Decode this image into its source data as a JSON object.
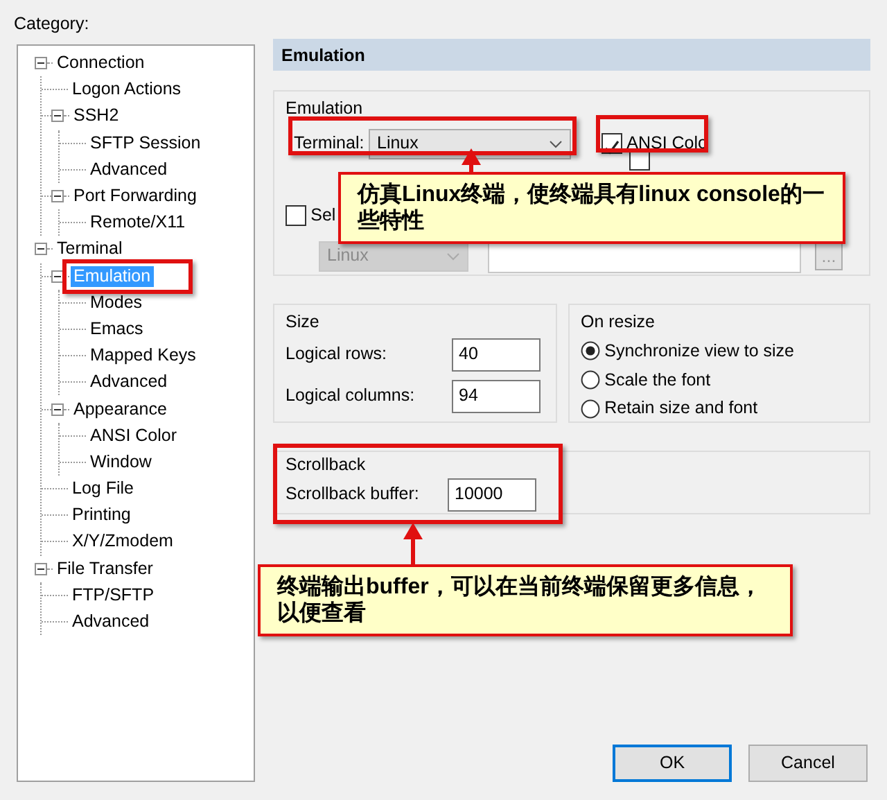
{
  "category_label": "Category:",
  "tree": [
    {
      "label": "Connection",
      "expanded": true,
      "selected": false,
      "children": [
        {
          "label": "Logon Actions",
          "selected": false
        },
        {
          "label": "SSH2",
          "expanded": true,
          "selected": false,
          "children": [
            {
              "label": "SFTP Session",
              "selected": false
            },
            {
              "label": "Advanced",
              "selected": false
            }
          ]
        },
        {
          "label": "Port Forwarding",
          "expanded": true,
          "selected": false,
          "children": [
            {
              "label": "Remote/X11",
              "selected": false
            }
          ]
        }
      ]
    },
    {
      "label": "Terminal",
      "expanded": true,
      "selected": false,
      "children": [
        {
          "label": "Emulation",
          "expanded": true,
          "selected": true,
          "children": [
            {
              "label": "Modes",
              "selected": false
            },
            {
              "label": "Emacs",
              "selected": false
            },
            {
              "label": "Mapped Keys",
              "selected": false
            },
            {
              "label": "Advanced",
              "selected": false
            }
          ]
        },
        {
          "label": "Appearance",
          "expanded": true,
          "selected": false,
          "children": [
            {
              "label": "ANSI Color",
              "selected": false
            },
            {
              "label": "Window",
              "selected": false
            }
          ]
        },
        {
          "label": "Log File",
          "selected": false
        },
        {
          "label": "Printing",
          "selected": false
        },
        {
          "label": "X/Y/Zmodem",
          "selected": false
        }
      ]
    },
    {
      "label": "File Transfer",
      "expanded": true,
      "selected": false,
      "children": [
        {
          "label": "FTP/SFTP",
          "selected": false
        },
        {
          "label": "Advanced",
          "selected": false
        }
      ]
    }
  ],
  "panel_title": "Emulation",
  "emulation": {
    "legend": "Emulation",
    "terminal_label": "Terminal:",
    "terminal_value": "Linux",
    "ansi_color": {
      "label": "ANSI Colo",
      "checked": true
    },
    "use_color_scheme": {
      "checked": false
    },
    "select": {
      "label": "Sel",
      "checked": false
    },
    "scheme_dropdown": {
      "value": "Linux",
      "disabled": true
    },
    "browse_button": "..."
  },
  "size": {
    "legend": "Size",
    "fields": [
      {
        "label": "Logical rows:",
        "value": "40"
      },
      {
        "label": "Logical columns:",
        "value": "94"
      }
    ]
  },
  "on_resize": {
    "legend": "On resize",
    "options": [
      {
        "label": "Synchronize view to size",
        "selected": true
      },
      {
        "label": "Scale the font",
        "selected": false
      },
      {
        "label": "Retain size and font",
        "selected": false
      }
    ]
  },
  "scrollback": {
    "legend": "Scrollback",
    "label": "Scrollback buffer:",
    "value": "10000"
  },
  "buttons": [
    {
      "label": "OK",
      "default": true
    },
    {
      "label": "Cancel",
      "default": false
    }
  ],
  "annotations": [
    {
      "text": "仿真Linux终端，使终端具有linux console的一些特性"
    },
    {
      "text": "终端输出buffer，可以在当前终端保留更多信息，以便查看"
    }
  ]
}
